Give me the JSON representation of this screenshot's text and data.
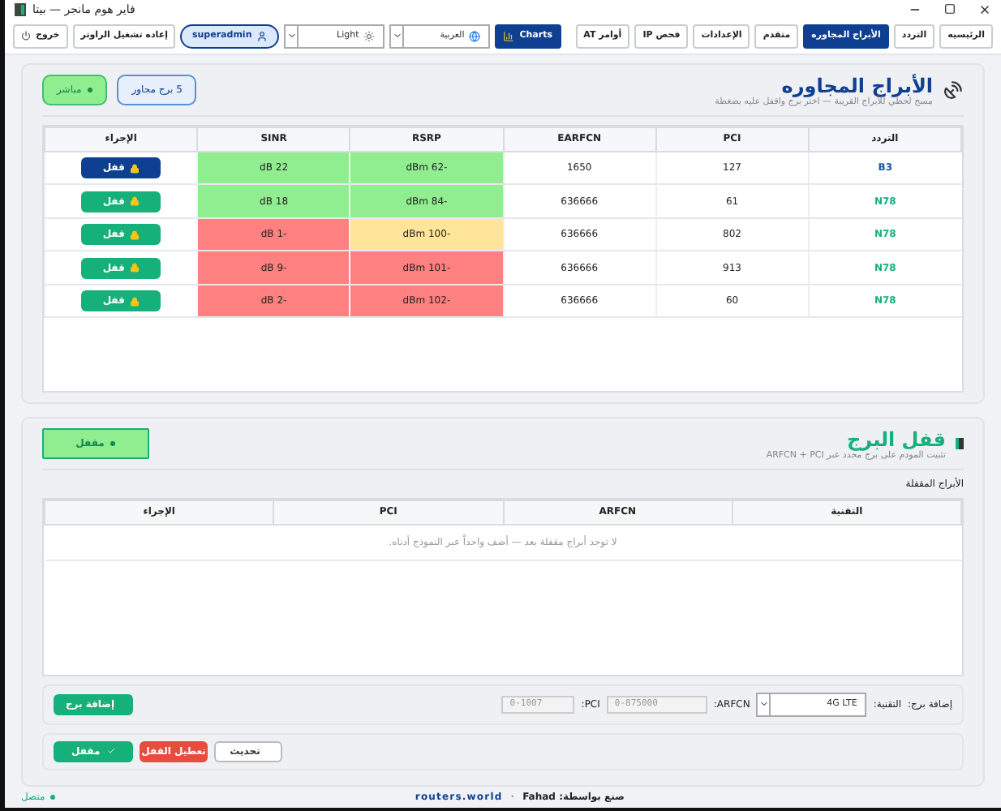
{
  "window": {
    "title": "فاير هوم مانجر — بيتا"
  },
  "nav": {
    "tabs": [
      {
        "label": "الرئيسيه",
        "selected": false
      },
      {
        "label": "التردد",
        "selected": false
      },
      {
        "label": "الأبراج المجاوره",
        "selected": true
      },
      {
        "label": "متقدم",
        "selected": false
      },
      {
        "label": "الإعدادات",
        "selected": false
      },
      {
        "label": "فحص IP",
        "selected": false
      },
      {
        "label": "أوامر AT",
        "selected": false
      }
    ],
    "charts_button": "Charts",
    "language": "العربية",
    "theme": "Light",
    "user": "superadmin",
    "reboot_button": "إعاده تشغيل الراوتر",
    "logout_button": "خروج"
  },
  "neighbors": {
    "title": "الأبراج المجاوره",
    "subtitle": "مسح لحظي للأبراج القريبة — اختر برج واقفل عليه بضغطة",
    "count_badge": "5 برج مجاور",
    "live_badge": "مباشر",
    "columns": [
      "التردد",
      "PCI",
      "EARFCN",
      "RSRP",
      "SINR",
      "الإجراء"
    ],
    "rows": [
      {
        "band": {
          "text": "B3",
          "color": "#1a56b0"
        },
        "pci": "127",
        "earfcn": "1650",
        "rsrp": {
          "text": "-62 dBm",
          "color": "#90ee90"
        },
        "sinr": {
          "text": "22 dB",
          "color": "#90ee90"
        },
        "action": {
          "label": "قفل",
          "selected": true
        }
      },
      {
        "band": {
          "text": "N78",
          "color": "#16b07a"
        },
        "pci": "61",
        "earfcn": "636666",
        "rsrp": {
          "text": "-84 dBm",
          "color": "#90ee90"
        },
        "sinr": {
          "text": "18 dB",
          "color": "#90ee90"
        },
        "action": {
          "label": "قفل",
          "selected": false
        }
      },
      {
        "band": {
          "text": "N78",
          "color": "#16b07a"
        },
        "pci": "802",
        "earfcn": "636666",
        "rsrp": {
          "text": "-100 dBm",
          "color": "#ffe599"
        },
        "sinr": {
          "text": "-1 dB",
          "color": "#ff8080"
        },
        "action": {
          "label": "قفل",
          "selected": false
        }
      },
      {
        "band": {
          "text": "N78",
          "color": "#16b07a"
        },
        "pci": "913",
        "earfcn": "636666",
        "rsrp": {
          "text": "-101 dBm",
          "color": "#ff8080"
        },
        "sinr": {
          "text": "-9 dB",
          "color": "#ff8080"
        },
        "action": {
          "label": "قفل",
          "selected": false
        }
      },
      {
        "band": {
          "text": "N78",
          "color": "#16b07a"
        },
        "pci": "60",
        "earfcn": "636666",
        "rsrp": {
          "text": "-102 dBm",
          "color": "#ff8080"
        },
        "sinr": {
          "text": "-2 dB",
          "color": "#ff8080"
        },
        "action": {
          "label": "قفل",
          "selected": false
        }
      }
    ]
  },
  "lock": {
    "title": "قفل البرج",
    "subtitle": "تثبيت المودم على برج محدد عبر ARFCN + PCI",
    "status_badge": "مقفل",
    "table_label": "الأبراج المقفلة",
    "columns": [
      "التقنية",
      "ARFCN",
      "PCI",
      "الإجراء"
    ],
    "empty_message": "لا توجد أبراج مقفلة بعد — أضف واحداً عبر النموذج أدناه.",
    "form": {
      "label": "إضافة برج:",
      "tech_label": "التقنية:",
      "tech_value": "4G LTE",
      "arfcn_label": "ARFCN:",
      "arfcn_placeholder": "0-875000",
      "pci_label": "PCI:",
      "pci_placeholder": "0-1007",
      "add_button": "إضافة برج"
    },
    "actions": {
      "locked_button": "مقفل",
      "disable_button": "تعطيل القفل",
      "refresh_button": "تحديث"
    }
  },
  "footer": {
    "status": "متصل",
    "credit": "صنع بواسطة: Fahad",
    "separator": "·",
    "link": "routers.world"
  }
}
